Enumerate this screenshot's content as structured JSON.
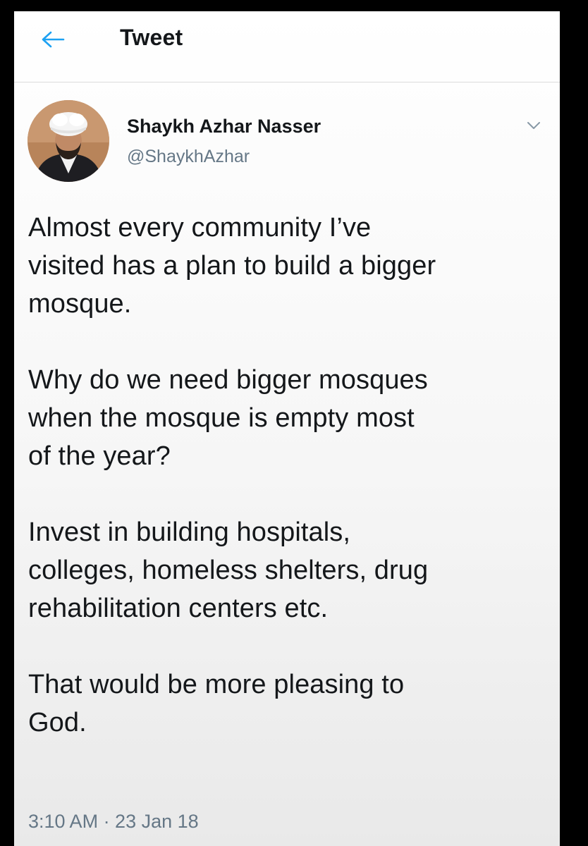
{
  "header": {
    "back_icon": "arrow-left-icon",
    "title": "Tweet"
  },
  "author": {
    "name": "Shaykh Azhar Nasser",
    "handle": "@ShaykhAzhar",
    "avatar": "profile-photo",
    "menu_icon": "chevron-down-icon"
  },
  "tweet": {
    "paragraphs": [
      {
        "lines": [
          "Almost every community I’ve",
          "visited has a plan to build a bigger",
          "mosque."
        ]
      },
      {
        "lines": [
          "Why do we need bigger mosques",
          "when the mosque is empty most",
          "of the year?"
        ]
      },
      {
        "lines": [
          "Invest in building hospitals,",
          "colleges, homeless shelters, drug",
          "rehabilitation centers etc."
        ]
      },
      {
        "lines": [
          "That would be more pleasing to",
          "God."
        ]
      }
    ],
    "timestamp": "3:10 AM · 23 Jan 18"
  },
  "colors": {
    "accent": "#1da1f2",
    "text": "#14171a",
    "muted": "#657786"
  }
}
